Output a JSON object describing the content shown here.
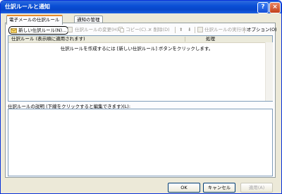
{
  "window": {
    "title": "仕訳ルールと通知",
    "help_label": "?",
    "close_label": "×"
  },
  "tabs": [
    {
      "label": "電子メールの仕訳ルール",
      "active": true
    },
    {
      "label": "通知の管理",
      "active": false
    }
  ],
  "toolbar": {
    "new_rule": "新しい仕訳ルール(N)...",
    "change_rule": "仕訳ルールの変更(H)",
    "copy": "コピー(C)...",
    "delete": "削除(D)",
    "move_up": "⬆",
    "move_down": "⬇",
    "run_rules": "仕訳ルールの実行(R)...",
    "options": "オプション(O)"
  },
  "rules_list": {
    "col_rule": "仕訳ルール (表示順に適用されます)",
    "col_action": "処理",
    "empty_message": "仕訳ルールを作成するには [新しい仕訳ルール] ボタンをクリックします。"
  },
  "description": {
    "label": "仕訳ルールの説明 (下線をクリックすると編集できます)(L):"
  },
  "buttons": {
    "ok": "OK",
    "cancel": "キャンセル",
    "apply": "適用(A)"
  }
}
